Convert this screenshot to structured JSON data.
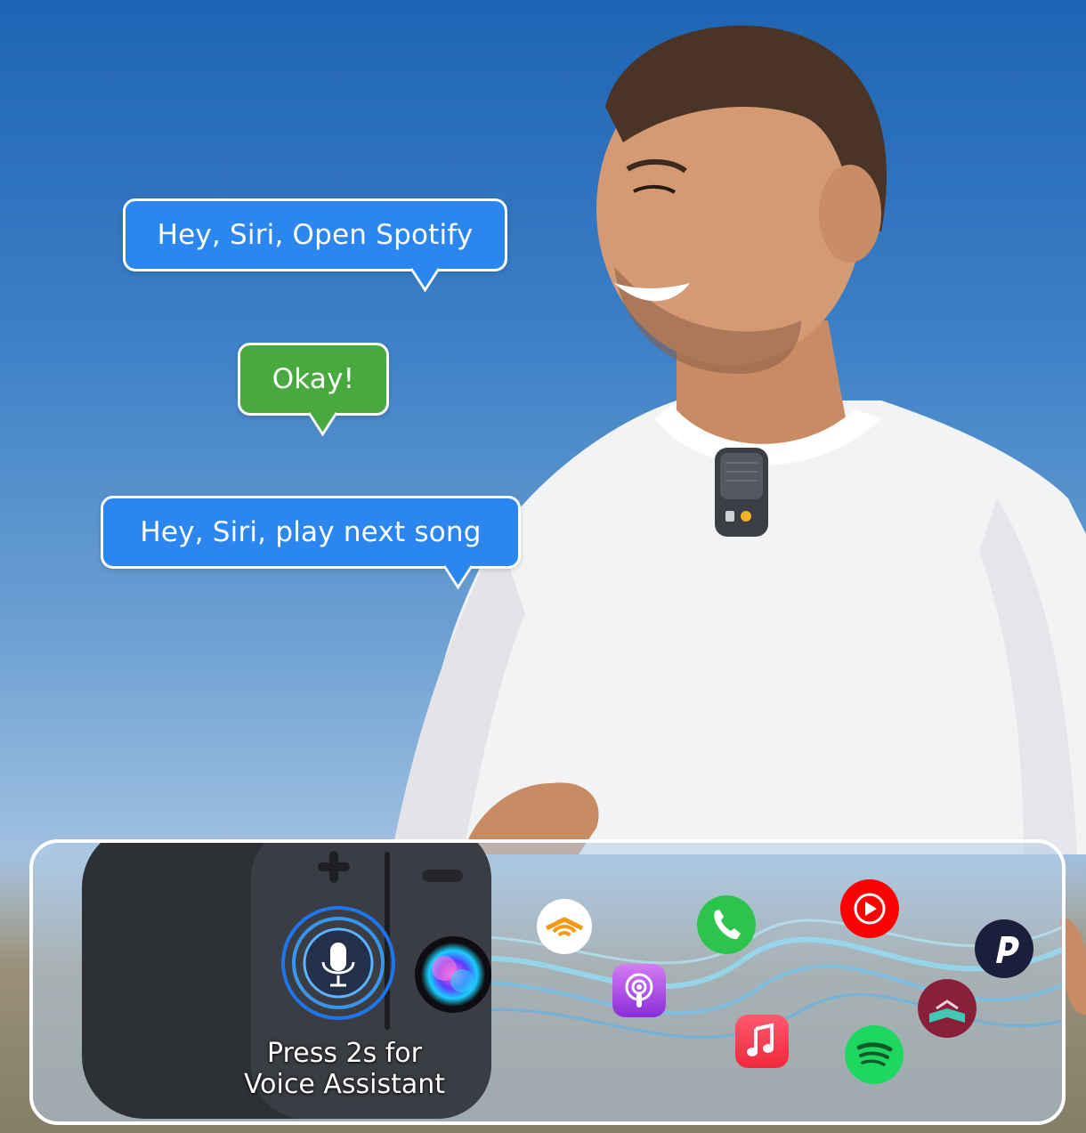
{
  "bubbles": {
    "first": "Hey, Siri, Open Spotify",
    "reply": "Okay!",
    "second": "Hey, Siri, play next song"
  },
  "panel": {
    "caption_line1": "Press 2s for",
    "caption_line2": "Voice Assistant",
    "apps": [
      "audible-icon",
      "podcasts-icon",
      "phone-icon",
      "apple-music-icon",
      "youtube-music-icon",
      "spotify-icon",
      "pandora-icon",
      "libby-icon",
      "siri-icon"
    ]
  },
  "colors": {
    "bubble_blue": "#2b86f0",
    "bubble_green": "#48aa3e",
    "sky": "#3a7ec6"
  }
}
